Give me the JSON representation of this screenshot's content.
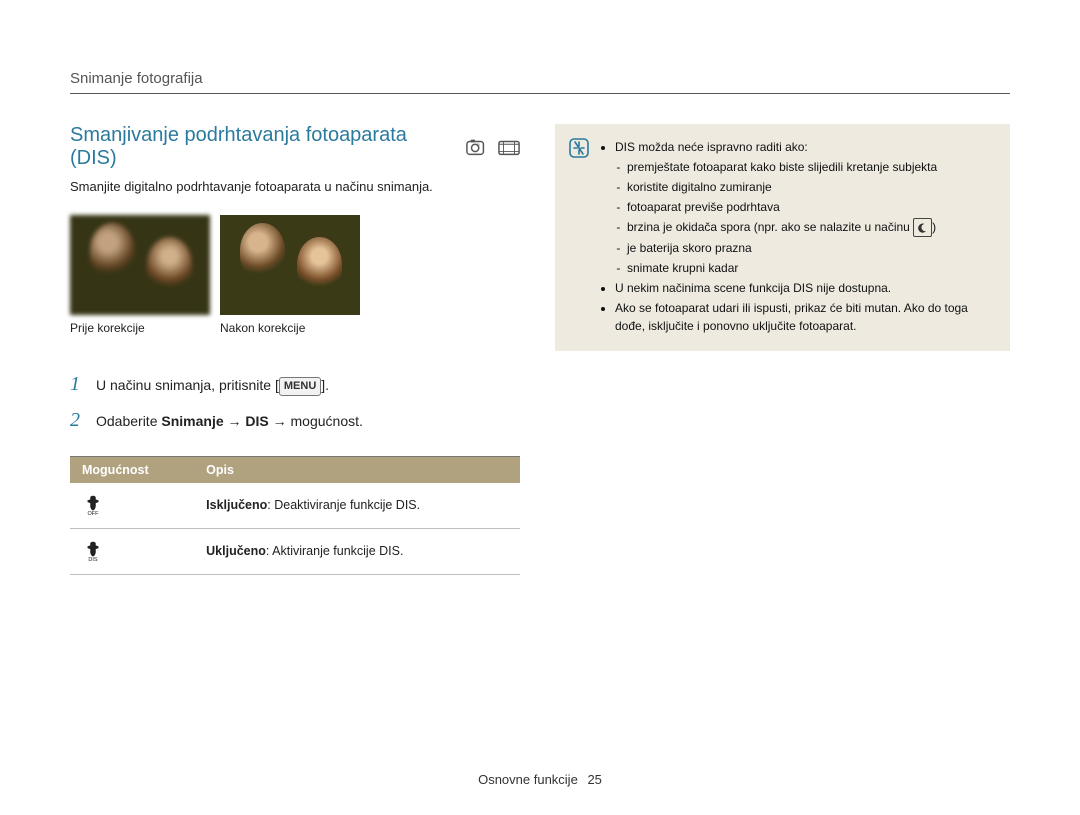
{
  "header": {
    "section": "Snimanje fotografija"
  },
  "title": "Smanjivanje podrhtavanja fotoaparata (DIS)",
  "intro": "Smanjite digitalno podrhtavanje fotoaparata u načinu snimanja.",
  "photos": {
    "before": "Prije korekcije",
    "after": "Nakon korekcije"
  },
  "steps": {
    "s1_pre": "U načinu snimanja, pritisnite [",
    "s1_btn": "MENU",
    "s1_post": "].",
    "s2_pre": "Odaberite ",
    "s2_bold": "Snimanje → DIS",
    "s2_post": " → mogućnost."
  },
  "table": {
    "head_option": "Mogućnost",
    "head_desc": "Opis",
    "row1_label": "Isključeno",
    "row1_desc": ": Deaktiviranje funkcije DIS.",
    "row1_sub": "OFF",
    "row2_label": "Uključeno",
    "row2_desc": ": Aktiviranje funkcije DIS.",
    "row2_sub": "DIS"
  },
  "info": {
    "b1": "DIS možda neće ispravno raditi ako:",
    "s1": "premještate fotoaparat kako biste slijedili kretanje subjekta",
    "s2": "koristite digitalno zumiranje",
    "s3": "fotoaparat previše podrhtava",
    "s4a": "brzina je okidača spora (npr. ako se nalazite u načinu ",
    "s4b": ")",
    "s5": "je baterija skoro prazna",
    "s6": "snimate krupni kadar",
    "b2": "U nekim načinima scene funkcija DIS nije dostupna.",
    "b3": "Ako se fotoaparat udari ili ispusti, prikaz će biti mutan. Ako do toga dođe, isključite i ponovno uključite fotoaparat."
  },
  "footer": {
    "label": "Osnovne funkcije",
    "page": "25"
  }
}
